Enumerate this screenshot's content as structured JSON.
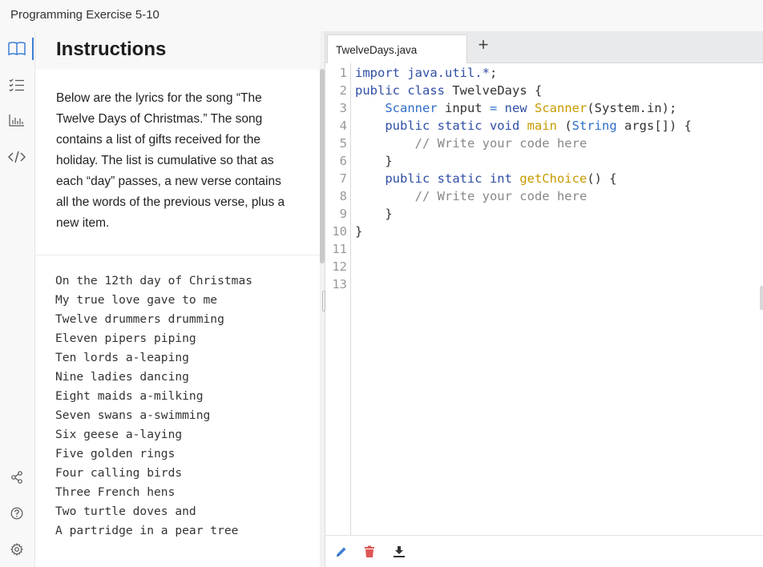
{
  "window": {
    "title": "Programming Exercise 5-10"
  },
  "rail": {
    "items": [
      {
        "name": "instructions",
        "icon": "book-icon"
      },
      {
        "name": "checklist",
        "icon": "checklist-icon"
      },
      {
        "name": "results",
        "icon": "bar-chart-icon"
      },
      {
        "name": "code",
        "icon": "code-icon"
      },
      {
        "name": "share",
        "icon": "share-icon"
      },
      {
        "name": "help",
        "icon": "help-icon"
      },
      {
        "name": "settings",
        "icon": "gear-icon"
      }
    ],
    "accent_color": "#3d7fd6"
  },
  "instructions": {
    "heading": "Instructions",
    "body": "Below are the lyrics for the song “The Twelve Days of Christmas.” The song contains a list of gifts received for the holiday. The list is cumulative so that as each “day” passes, a new verse contains all the words of the previous verse, plus a new item.",
    "lyrics": [
      "On the 12th day of Christmas",
      "My true love gave to me",
      "Twelve drummers drumming",
      "Eleven pipers piping",
      "Ten lords a-leaping",
      "Nine ladies dancing",
      "Eight maids a-milking",
      "Seven swans a-swimming",
      "Six geese a-laying",
      "Five golden rings",
      "Four calling birds",
      "Three French hens",
      "Two turtle doves and",
      "A partridge in a pear tree"
    ]
  },
  "editor": {
    "tab_label": "TwelveDays.java",
    "add_tab_label": "+",
    "line_numbers": [
      "1",
      "2",
      "3",
      "4",
      "5",
      "6",
      "7",
      "8",
      "9",
      "10",
      "11",
      "12",
      "13"
    ],
    "code_lines": [
      [
        {
          "t": "import ",
          "c": "kw"
        },
        {
          "t": "java.util.*",
          "c": "pkg"
        },
        {
          "t": ";",
          "c": ""
        }
      ],
      [
        {
          "t": "public class ",
          "c": "kw"
        },
        {
          "t": "TwelveDays {",
          "c": ""
        }
      ],
      [
        {
          "t": "    ",
          "c": ""
        },
        {
          "t": "Scanner",
          "c": "type"
        },
        {
          "t": " input ",
          "c": ""
        },
        {
          "t": "=",
          "c": "op"
        },
        {
          "t": " ",
          "c": ""
        },
        {
          "t": "new",
          "c": "kw"
        },
        {
          "t": " ",
          "c": ""
        },
        {
          "t": "Scanner",
          "c": "cls"
        },
        {
          "t": "(System.in);",
          "c": ""
        }
      ],
      [
        {
          "t": "    ",
          "c": ""
        },
        {
          "t": "public static void",
          "c": "kw"
        },
        {
          "t": " ",
          "c": ""
        },
        {
          "t": "main",
          "c": "fn"
        },
        {
          "t": " (",
          "c": ""
        },
        {
          "t": "String",
          "c": "type"
        },
        {
          "t": " args[]) {",
          "c": ""
        }
      ],
      [
        {
          "t": "        // Write your code here",
          "c": "cm"
        }
      ],
      [
        {
          "t": "    }",
          "c": ""
        }
      ],
      [
        {
          "t": "    ",
          "c": ""
        },
        {
          "t": "public static int",
          "c": "kw"
        },
        {
          "t": " ",
          "c": ""
        },
        {
          "t": "getChoice",
          "c": "fn"
        },
        {
          "t": "() {",
          "c": ""
        }
      ],
      [
        {
          "t": "        // Write your code here",
          "c": "cm"
        }
      ],
      [
        {
          "t": "    }",
          "c": ""
        }
      ],
      [
        {
          "t": "}",
          "c": ""
        }
      ],
      [],
      [],
      []
    ],
    "toolbar": [
      {
        "name": "edit",
        "icon": "pencil-icon",
        "color": "#3d7fd6"
      },
      {
        "name": "delete",
        "icon": "trash-icon",
        "color": "#e05555"
      },
      {
        "name": "download",
        "icon": "download-icon",
        "color": "#333333"
      }
    ]
  }
}
